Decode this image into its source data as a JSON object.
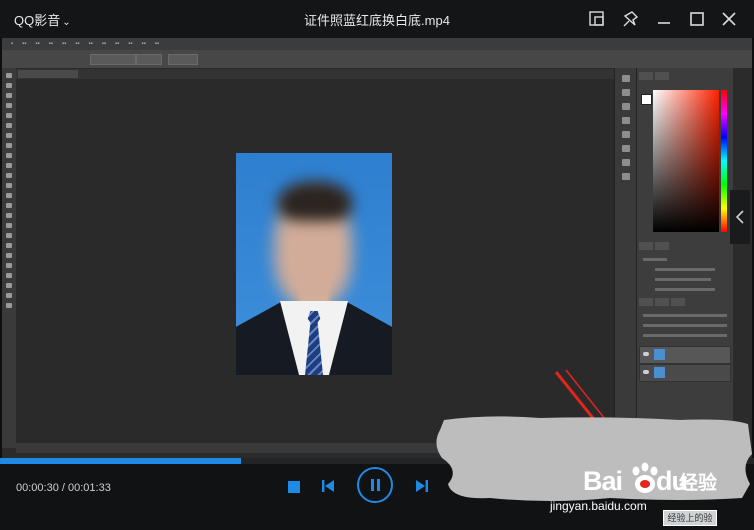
{
  "window": {
    "app_name": "QQ影音",
    "file_title": "证件照蓝红底换白底.mp4"
  },
  "titlebar_icons": [
    "playlist-icon",
    "pin-icon",
    "minimize-icon",
    "maximize-icon",
    "close-icon"
  ],
  "player": {
    "time": "00:00:30 / 00:01:33",
    "progress_fraction": 0.32,
    "accent_color": "#1f8ae6"
  },
  "watermark": {
    "bai": "Bai",
    "du": "du",
    "brand_zh": "经验",
    "url": "jingyan.baidu.com",
    "sub_label": "经验上的验"
  }
}
